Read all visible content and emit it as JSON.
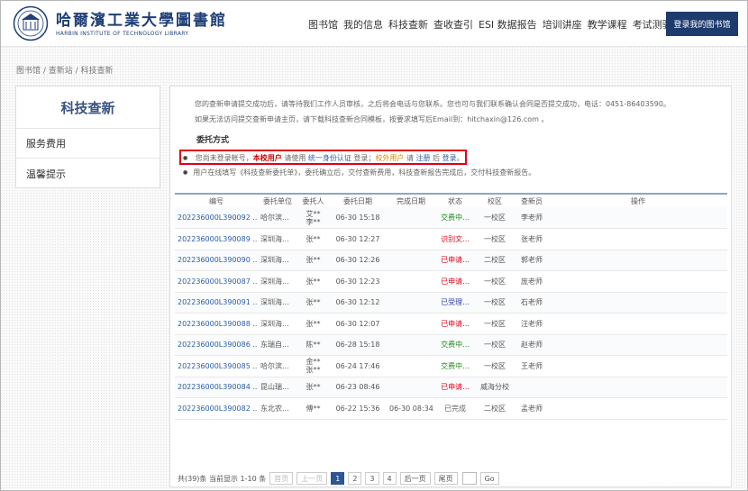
{
  "header": {
    "logo_title": "哈爾濱工業大學圖書館",
    "logo_sub": "HARBIN INSTITUTE OF TECHNOLOGY LIBRARY",
    "nav": [
      "图书馆",
      "我的信息",
      "科技查新",
      "查收查引",
      "ESI 数据报告",
      "培训讲座",
      "教学课程",
      "考试测验"
    ],
    "login_label": "登录我的图书馆"
  },
  "breadcrumb": "图书馆 / 查新站 / 科技查新",
  "sidebar": {
    "title": "科技查新",
    "items": [
      "服务费用",
      "温馨提示"
    ]
  },
  "notices": {
    "line1": "您的查新申请提交成功后，请等待我们工作人员审核，之后将会电话与您联系。您也可与我们联系确认会同是否提交成功，电话：0451-86403590。",
    "line2": "如果无法访问提交查新申请主页，请下载科技查新合同模板，按要求填写后Email到：hitchaxin@126.com 。",
    "section_title": "委托方式",
    "bullet1": {
      "prefix": "您尚未登录帐号，",
      "campus_user": "本校用户",
      "mid1": " 请使用 ",
      "auth_link": "统一身份认证",
      "mid2": " 登录；",
      "external_user": "校外用户",
      "mid3": " 请 ",
      "register_link": "注册",
      "mid4": " 后 ",
      "login_link": "登录",
      "suffix": "。"
    },
    "bullet2": "用户在线填写《科技查新委托单》，委托确立后，交付查新费用，科技查新报告完成后，交付科技查新报告。"
  },
  "table": {
    "headers": [
      "编号",
      "委托单位",
      "委托人",
      "委托日期",
      "完成日期",
      "状态",
      "校区",
      "查新员",
      "操作"
    ],
    "rows": [
      {
        "id": "202236000L390092 ...",
        "unit": "哈尔滨...",
        "client": "艾**\n李**",
        "date": "06-30 15:18",
        "finish": "",
        "status": "交费中...",
        "status_class": "st-green",
        "campus": "一校区",
        "staff": "李老师"
      },
      {
        "id": "202236000L390089 ...",
        "unit": "深圳海...",
        "client": "张**",
        "date": "06-30 12:27",
        "finish": "",
        "status": "识别文...",
        "status_class": "st-red",
        "campus": "一校区",
        "staff": "张老师"
      },
      {
        "id": "202236000L390090 ...",
        "unit": "深圳海...",
        "client": "张**",
        "date": "06-30 12:26",
        "finish": "",
        "status": "已申请...",
        "status_class": "st-red",
        "campus": "二校区",
        "staff": "郭老师"
      },
      {
        "id": "202236000L390087 ...",
        "unit": "深圳海...",
        "client": "张**",
        "date": "06-30 12:23",
        "finish": "",
        "status": "已申请...",
        "status_class": "st-red",
        "campus": "一校区",
        "staff": "庞老师"
      },
      {
        "id": "202236000L390091 ...",
        "unit": "深圳海...",
        "client": "张**",
        "date": "06-30 12:12",
        "finish": "",
        "status": "已受理...",
        "status_class": "st-blue",
        "campus": "一校区",
        "staff": "石老师"
      },
      {
        "id": "202236000L390088 ...",
        "unit": "深圳海...",
        "client": "张**",
        "date": "06-30 12:07",
        "finish": "",
        "status": "已申请...",
        "status_class": "st-red",
        "campus": "一校区",
        "staff": "汪老师"
      },
      {
        "id": "202236000L390086 ...",
        "unit": "东瑞自...",
        "client": "陈**",
        "date": "06-28 15:18",
        "finish": "",
        "status": "交费中...",
        "status_class": "st-green",
        "campus": "一校区",
        "staff": "赵老师"
      },
      {
        "id": "202236000L390085 ...",
        "unit": "哈尔滨...",
        "client": "金**\n张**",
        "date": "06-24 17:46",
        "finish": "",
        "status": "交费中...",
        "status_class": "st-green",
        "campus": "一校区",
        "staff": "王老师"
      },
      {
        "id": "202236000L390084 ...",
        "unit": "昆山瑞...",
        "client": "张**",
        "date": "06-23 08:46",
        "finish": "",
        "status": "已申请...",
        "status_class": "st-red",
        "campus": "威海分校",
        "staff": ""
      },
      {
        "id": "202236000L390082 ...",
        "unit": "东北农...",
        "client": "傅**",
        "date": "06-22 15:36",
        "finish": "06-30 08:34",
        "status": "已完成",
        "status_class": "st-gray",
        "campus": "二校区",
        "staff": "孟老师"
      }
    ]
  },
  "pager": {
    "summary": "共(39)条  当前显示 1-10 条",
    "first": "首页",
    "prev": "上一页",
    "pages": [
      "1",
      "2",
      "3",
      "4"
    ],
    "next": "后一页",
    "last": "尾页",
    "go": "Go"
  }
}
